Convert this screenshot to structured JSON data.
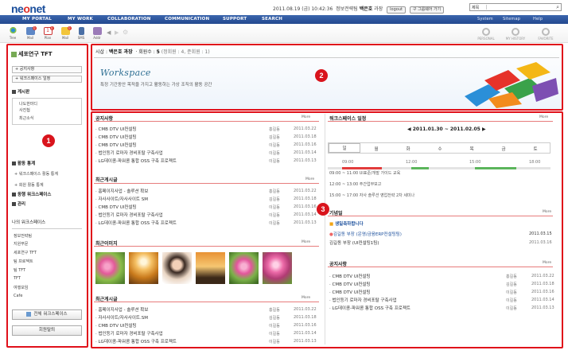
{
  "top": {
    "logo_pre": "ne",
    "logo_o": "o",
    "logo_post": "net",
    "datetime": "2011.08.19 (금) 10:42:36",
    "dept": "정보전략팀",
    "user": "백은호",
    "title": "과장",
    "logout": "logout",
    "group": "구 그룹웨어 가기",
    "search_scope": "제목",
    "search_icon": "search-icon"
  },
  "nav": {
    "items": [
      "MY PORTAL",
      "MY WORK",
      "COLLABORATION",
      "COMMUNICATION",
      "SUPPORT",
      "SEARCH"
    ],
    "right": [
      "System",
      "Sitemap",
      "Help"
    ]
  },
  "toolbar": {
    "items": [
      {
        "label": "Tree",
        "icon": "tree-icon"
      },
      {
        "label": "Mail",
        "icon": "mail-icon",
        "badge": "0"
      },
      {
        "label": "Plan",
        "icon": "calendar-icon",
        "badge": "0",
        "num": "1"
      },
      {
        "label": "Mail",
        "icon": "folder-icon",
        "badge": "0"
      },
      {
        "label": "SMS",
        "icon": "phone-icon"
      },
      {
        "label": "Addr",
        "icon": "addressbook-icon"
      }
    ],
    "right": [
      {
        "label": "PERSONAL",
        "icon": "personal-icon"
      },
      {
        "label": "MY HISTORY",
        "icon": "history-icon"
      },
      {
        "label": "FAVORITE",
        "icon": "favorite-icon"
      }
    ]
  },
  "left": {
    "title": "세포연구 TFT",
    "menu1": "공지사항",
    "menu2": "워크스페이스 일정",
    "board": "게시판",
    "board_items": [
      "나도한마디",
      "사진첩",
      "최근소식"
    ],
    "stats": "활동 통계",
    "stats_items": [
      "워크스페이스 활동 통계",
      "회원 활동 통계"
    ],
    "peer": "동행 워크스페이스",
    "admin": "관리",
    "mine": "나의 워크스페이스",
    "mine_items": [
      "정보전략팀",
      "지원부문",
      "세포연구 TFT",
      "팀 프로젝트",
      "팀 TFT",
      "TFT",
      "여행모임",
      "Cafe"
    ],
    "btn_all": "전체 워크스페이스",
    "btn_leave": "회원탈퇴"
  },
  "banner": {
    "leader_label": "시삽 :",
    "leader": "백은호 과장",
    "members_label": "· 회원수 :",
    "members": "5",
    "members_detail": "(정회원 : 4, 준회원 : 1)",
    "title": "Workspace",
    "desc": "특정 기간동안 목적을 가지고 활동하는 가상 조직의 활동 공간"
  },
  "notice": {
    "title": "공지사항",
    "more": "More",
    "rows": [
      [
        "CMB DTV UI컨설팅",
        "홍길동",
        "2011.03.22"
      ],
      [
        "CMB DTV UI컨설팅",
        "김길동",
        "2011.03.18"
      ],
      [
        "CMB DTV UI컨설팅",
        "이길동",
        "2011.03.16"
      ],
      [
        "법인등기 로마자 경비포탈 구축사업",
        "이길동",
        "2011.03.14"
      ],
      [
        "LG데이콤-파워콤 통합 OSS 구축 프로젝트",
        "이길동",
        "2011.03.13"
      ]
    ]
  },
  "recent": {
    "title": "최근게시글",
    "more": "More",
    "rows": [
      [
        "홈페이지사업 - 솔루션 확보",
        "홍길동",
        "2011.03.22"
      ],
      [
        "자사사이트/자사사이트 SM",
        "김길동",
        "2011.03.18"
      ],
      [
        "CMB DTV UI컨설팅",
        "이길동",
        "2011.03.16"
      ],
      [
        "법인등기 로마자 경비포탈 구축사업",
        "이길동",
        "2011.03.14"
      ],
      [
        "LG데이콤-파워콤 통합 OSS 구축 프로젝트",
        "이길동",
        "2011.03.13"
      ]
    ]
  },
  "images": {
    "title": "최근이미지",
    "more": "More"
  },
  "recent2": {
    "title": "최근게시글",
    "more": "More",
    "rows": [
      [
        "홈페이지사업 - 솔루션 확보",
        "홍길동",
        "2011.03.22"
      ],
      [
        "자사사이트/자사사이트.SM",
        "김길동",
        "2011.03.18"
      ],
      [
        "CMB DTV UI컨설팅",
        "이길동",
        "2011.03.16"
      ],
      [
        "법인등기 로마자 경비포탈 구축사업",
        "이길동",
        "2011.03.14"
      ],
      [
        "LG데이콤-파워콤 통합 OSS 구축 프로젝트",
        "이길동",
        "2011.03.13"
      ]
    ]
  },
  "schedule": {
    "title": "워크스페이스 일정",
    "more": "More",
    "range": "2011.01.30 ~ 2011.02.05",
    "days": [
      "일",
      "월",
      "화",
      "수",
      "목",
      "금",
      "토"
    ],
    "times": [
      "09:00",
      "12:00",
      "15:00",
      "18:00"
    ],
    "events": [
      "09:00 ~ 11:00 UI표준/개발 가이드 교육",
      "12:00 ~ 13:00 주간업무보고",
      "15:00 ~ 17:00 자사 솔루션 영업전략 2차 세미나"
    ]
  },
  "birthday": {
    "title": "기념일",
    "more": "More",
    "headline": "생일축하합니다",
    "rows": [
      [
        "김길동 부장 (운영/금융ERP컨설팅팀)",
        "2011.03.15"
      ],
      [
        "김길동 부장 (UI컨설팅1팀)",
        "2011.03.16"
      ]
    ]
  },
  "notice2": {
    "title": "공지사항",
    "more": "More",
    "rows": [
      [
        "CMB DTV UI컨설팅",
        "홍길동",
        "2011.03.22"
      ],
      [
        "CMB DTV UI컨설팅",
        "김길동",
        "2011.03.18"
      ],
      [
        "CMB DTV UI컨설팅",
        "이길동",
        "2011.03.16"
      ],
      [
        "법인등기 로마자 경비포탈 구축사업",
        "이길동",
        "2011.03.14"
      ],
      [
        "LG데이콤-파워콤 통합 OSS 구축 프로젝트",
        "이길동",
        "2011.03.13"
      ]
    ]
  },
  "markers": [
    "1",
    "2",
    "3"
  ]
}
